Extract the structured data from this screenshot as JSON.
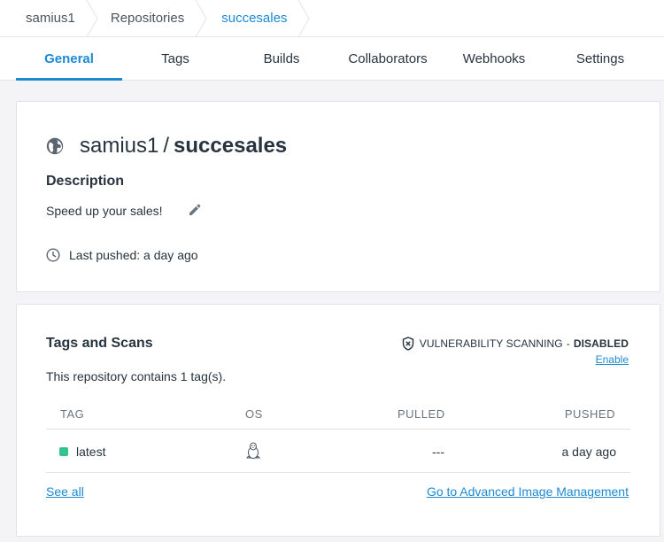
{
  "breadcrumb": {
    "items": [
      "samius1",
      "Repositories",
      "succesales"
    ]
  },
  "tabs": [
    "General",
    "Tags",
    "Builds",
    "Collaborators",
    "Webhooks",
    "Settings"
  ],
  "active_tab": "General",
  "repo": {
    "namespace": "samius1",
    "slash": "/",
    "name": "succesales",
    "icon": "globe-icon",
    "description_heading": "Description",
    "description": "Speed up your sales!",
    "last_pushed": "Last pushed: a day ago"
  },
  "scans": {
    "heading": "Tags and Scans",
    "vulnerability_label": "VULNERABILITY SCANNING",
    "vulnerability_dash": "-",
    "vulnerability_status": "DISABLED",
    "enable_label": "Enable",
    "tag_count_text": "This repository contains 1 tag(s).",
    "columns": [
      "TAG",
      "OS",
      "PULLED",
      "PUSHED"
    ],
    "rows": [
      {
        "tag": "latest",
        "os": "linux-icon",
        "pulled": "---",
        "pushed": "a day ago",
        "status_color": "#31c48d"
      }
    ],
    "see_all": "See all",
    "advanced_link": "Go to Advanced Image Management"
  },
  "colors": {
    "accent": "#1b8ad3",
    "text": "#27343f",
    "background": "#f4f4f6"
  }
}
